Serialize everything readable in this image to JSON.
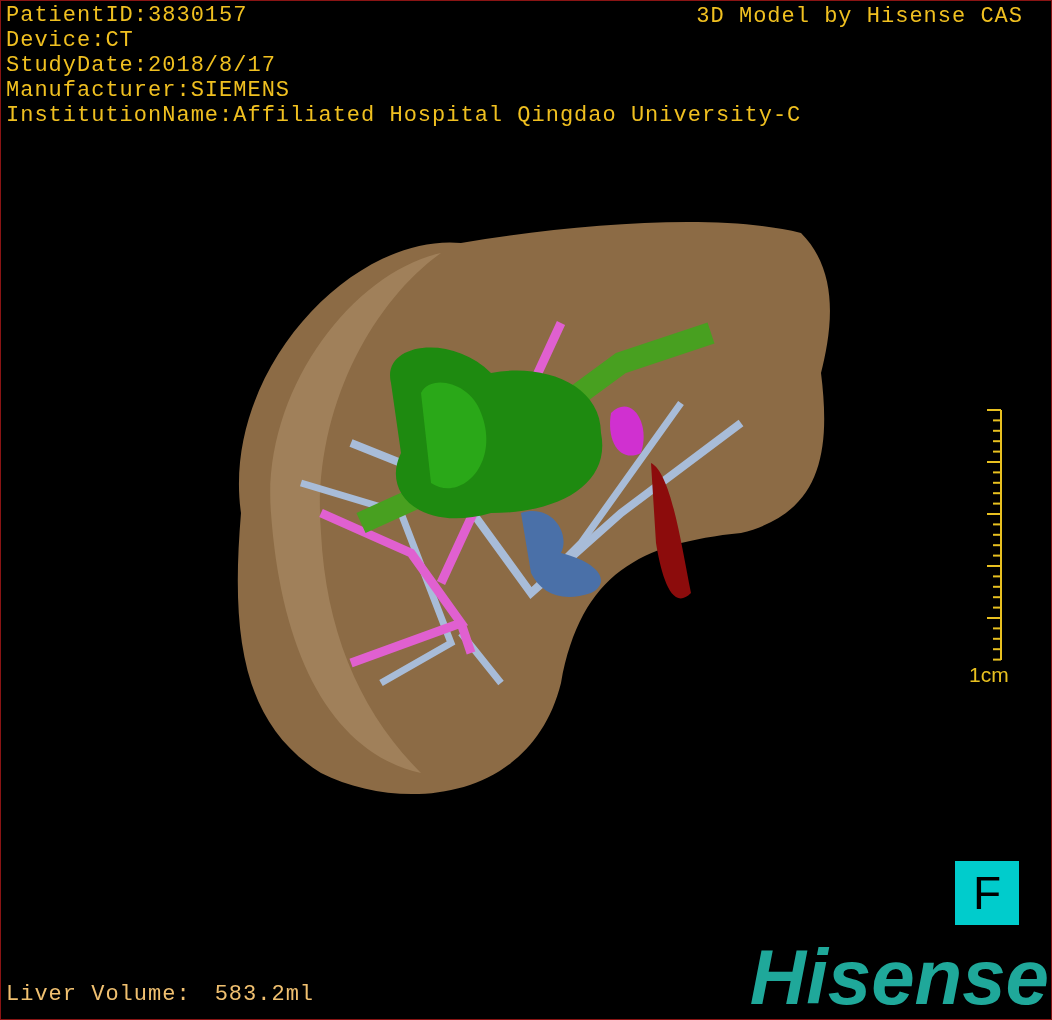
{
  "info_lines": [
    "PatientID:3830157",
    "Device:CT",
    "StudyDate:2018/8/17",
    "Manufacturer:SIEMENS",
    "InstitutionName:Affiliated Hospital Qingdao University-C"
  ],
  "title": "3D Model by Hisense CAS",
  "scale": {
    "label": "1cm"
  },
  "orientation": "F",
  "volume": {
    "label": "Liver Volume:",
    "value": "583.2ml"
  },
  "logo": "Hisense"
}
